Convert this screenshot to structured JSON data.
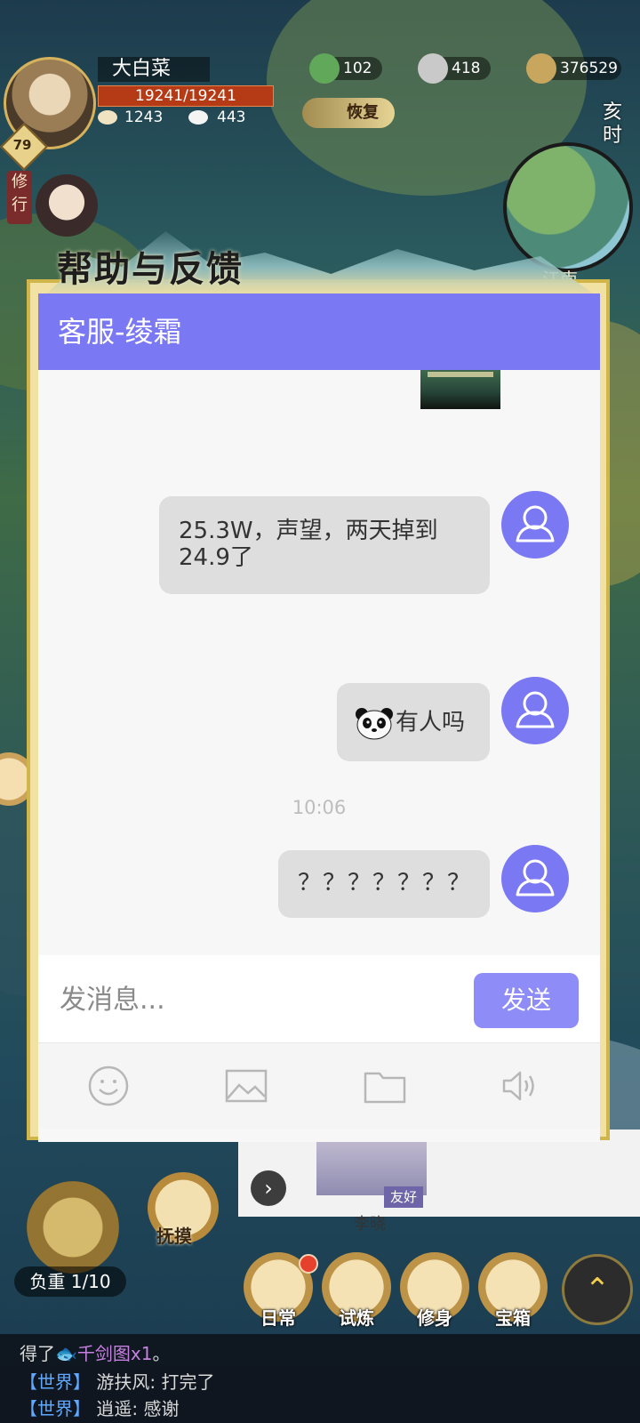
{
  "hud": {
    "player_name": "大白菜",
    "level": "79",
    "hp": "19241/19241",
    "stat_a": "1243",
    "stat_b": "443",
    "resource_1": "102",
    "resource_2": "418",
    "resource_3": "376529",
    "recover_label": "恢复",
    "time_label": "亥时",
    "region": "江南",
    "practice_tag": "修行"
  },
  "dialog": {
    "title": "帮助与反馈",
    "header": "客服-绫霜",
    "messages": [
      {
        "text": "25.3W，声望，两天掉到24.9了"
      },
      {
        "text": "有人吗"
      },
      {
        "text": "？？？？？？？"
      }
    ],
    "timestamp": "10:06",
    "input_placeholder": "发消息...",
    "send_label": "发送",
    "tools": [
      "smile-icon",
      "image-icon",
      "folder-icon",
      "speaker-icon"
    ],
    "colors": {
      "accent": "#7b78f3",
      "send": "#8e8cf6",
      "bubble": "#dedede"
    }
  },
  "bottom": {
    "touch_label": "抚摸",
    "load_label": "负重 1/10",
    "friend_tag": "友好",
    "friend_name": "李晓",
    "menu": [
      {
        "label": "日常"
      },
      {
        "label": "试炼"
      },
      {
        "label": "修身"
      },
      {
        "label": "宝箱"
      }
    ]
  },
  "chat_log": [
    {
      "prefix": "得了",
      "item": "千剑图x1",
      "suffix": "。"
    },
    {
      "channel": "【世界】",
      "text": "游扶风: 打完了"
    },
    {
      "channel": "【世界】",
      "text": "逍遥: 感谢"
    }
  ]
}
